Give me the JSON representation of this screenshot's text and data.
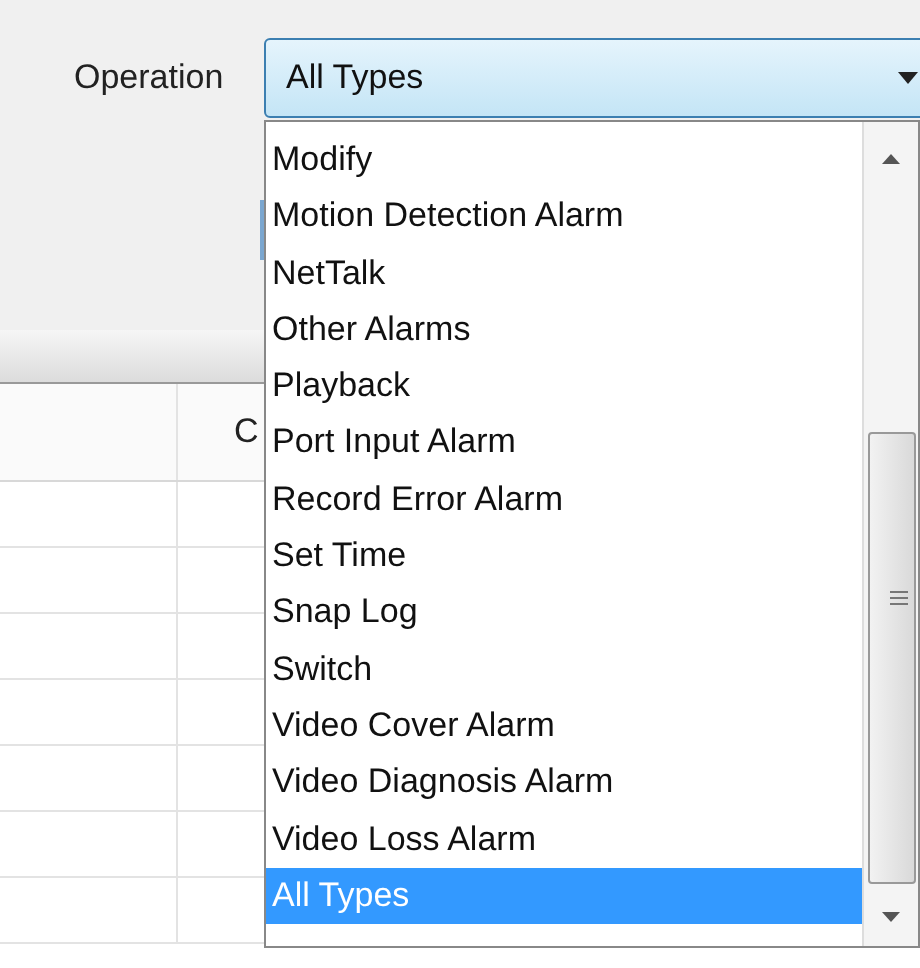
{
  "operation": {
    "label": "Operation",
    "value": "All Types",
    "expanded": true,
    "options": [
      {
        "label": "Modify",
        "selected": false
      },
      {
        "label": "Motion Detection Alarm",
        "selected": false
      },
      {
        "label": "NetTalk",
        "selected": false
      },
      {
        "label": "Other Alarms",
        "selected": false
      },
      {
        "label": "Playback",
        "selected": false
      },
      {
        "label": "Port Input Alarm",
        "selected": false
      },
      {
        "label": "Record Error Alarm",
        "selected": false
      },
      {
        "label": "Set Time",
        "selected": false
      },
      {
        "label": "Snap Log",
        "selected": false
      },
      {
        "label": "Switch",
        "selected": false
      },
      {
        "label": "Video Cover Alarm",
        "selected": false
      },
      {
        "label": "Video Diagnosis Alarm",
        "selected": false
      },
      {
        "label": "Video Loss Alarm",
        "selected": false
      },
      {
        "label": "All Types",
        "selected": true
      }
    ]
  },
  "table": {
    "columns": [
      {
        "label": "C"
      }
    ]
  }
}
